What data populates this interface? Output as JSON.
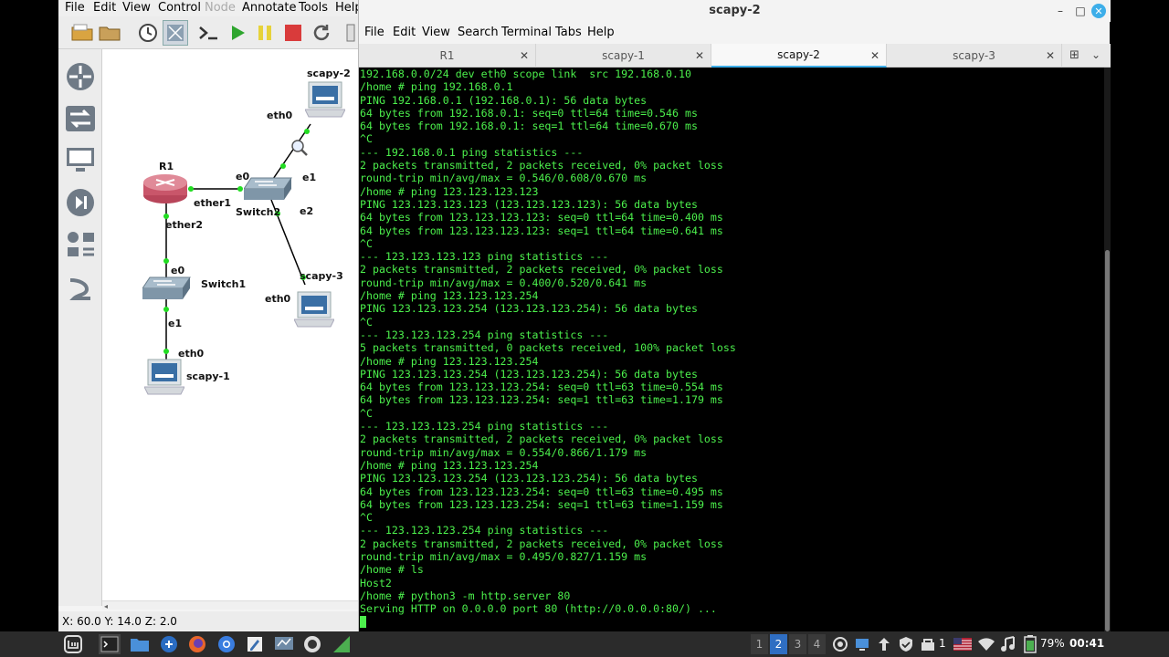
{
  "gns3": {
    "menu": [
      "File",
      "Edit",
      "View",
      "Control",
      "Node",
      "Annotate",
      "Tools",
      "Help"
    ],
    "status": "X: 60.0 Y: 14.0 Z: 2.0",
    "nodes": {
      "r1": "R1",
      "switch1": "Switch1",
      "switch2": "Switch2",
      "scapy1": "scapy-1",
      "scapy2": "scapy-2",
      "scapy3": "scapy-3"
    },
    "ports": {
      "r1_ether1": "ether1",
      "r1_ether2": "ether2",
      "sw2_e0": "e0",
      "sw2_e1": "e1",
      "sw2_e2": "e2",
      "sw1_e0": "e0",
      "sw1_e1": "e1",
      "scapy1_eth0": "eth0",
      "scapy2_eth0": "eth0",
      "scapy3_eth0": "eth0"
    }
  },
  "terminal": {
    "title": "scapy-2",
    "menu": [
      "File",
      "Edit",
      "View",
      "Search",
      "Terminal",
      "Tabs",
      "Help"
    ],
    "tabs": [
      {
        "label": "R1"
      },
      {
        "label": "scapy-1"
      },
      {
        "label": "scapy-2"
      },
      {
        "label": "scapy-3"
      }
    ],
    "lines": [
      "192.168.0.0/24 dev eth0 scope link  src 192.168.0.10",
      "/home # ping 192.168.0.1",
      "PING 192.168.0.1 (192.168.0.1): 56 data bytes",
      "64 bytes from 192.168.0.1: seq=0 ttl=64 time=0.546 ms",
      "64 bytes from 192.168.0.1: seq=1 ttl=64 time=0.670 ms",
      "^C",
      "--- 192.168.0.1 ping statistics ---",
      "2 packets transmitted, 2 packets received, 0% packet loss",
      "round-trip min/avg/max = 0.546/0.608/0.670 ms",
      "/home # ping 123.123.123.123",
      "PING 123.123.123.123 (123.123.123.123): 56 data bytes",
      "64 bytes from 123.123.123.123: seq=0 ttl=64 time=0.400 ms",
      "64 bytes from 123.123.123.123: seq=1 ttl=64 time=0.641 ms",
      "^C",
      "--- 123.123.123.123 ping statistics ---",
      "2 packets transmitted, 2 packets received, 0% packet loss",
      "round-trip min/avg/max = 0.400/0.520/0.641 ms",
      "/home # ping 123.123.123.254",
      "PING 123.123.123.254 (123.123.123.254): 56 data bytes",
      "^C",
      "--- 123.123.123.254 ping statistics ---",
      "5 packets transmitted, 0 packets received, 100% packet loss",
      "/home # ping 123.123.123.254",
      "PING 123.123.123.254 (123.123.123.254): 56 data bytes",
      "64 bytes from 123.123.123.254: seq=0 ttl=63 time=0.554 ms",
      "64 bytes from 123.123.123.254: seq=1 ttl=63 time=1.179 ms",
      "^C",
      "--- 123.123.123.254 ping statistics ---",
      "2 packets transmitted, 2 packets received, 0% packet loss",
      "round-trip min/avg/max = 0.554/0.866/1.179 ms",
      "/home # ping 123.123.123.254",
      "PING 123.123.123.254 (123.123.123.254): 56 data bytes",
      "64 bytes from 123.123.123.254: seq=0 ttl=63 time=0.495 ms",
      "64 bytes from 123.123.123.254: seq=1 ttl=63 time=1.159 ms",
      "^C",
      "--- 123.123.123.254 ping statistics ---",
      "2 packets transmitted, 2 packets received, 0% packet loss",
      "round-trip min/avg/max = 0.495/0.827/1.159 ms",
      "/home # ls",
      "Host2",
      "/home # python3 -m http.server 80",
      "Serving HTTP on 0.0.0.0 port 80 (http://0.0.0.0:80/) ..."
    ]
  },
  "taskbar": {
    "workspaces": [
      "1",
      "2",
      "3",
      "4"
    ],
    "battery": "79%",
    "clock": "00:41",
    "indicator": "1"
  },
  "colors": {
    "terminal_fg": "#4cf04c",
    "tab_accent": "#3daee9",
    "workspace_active": "#2f6ec2"
  }
}
